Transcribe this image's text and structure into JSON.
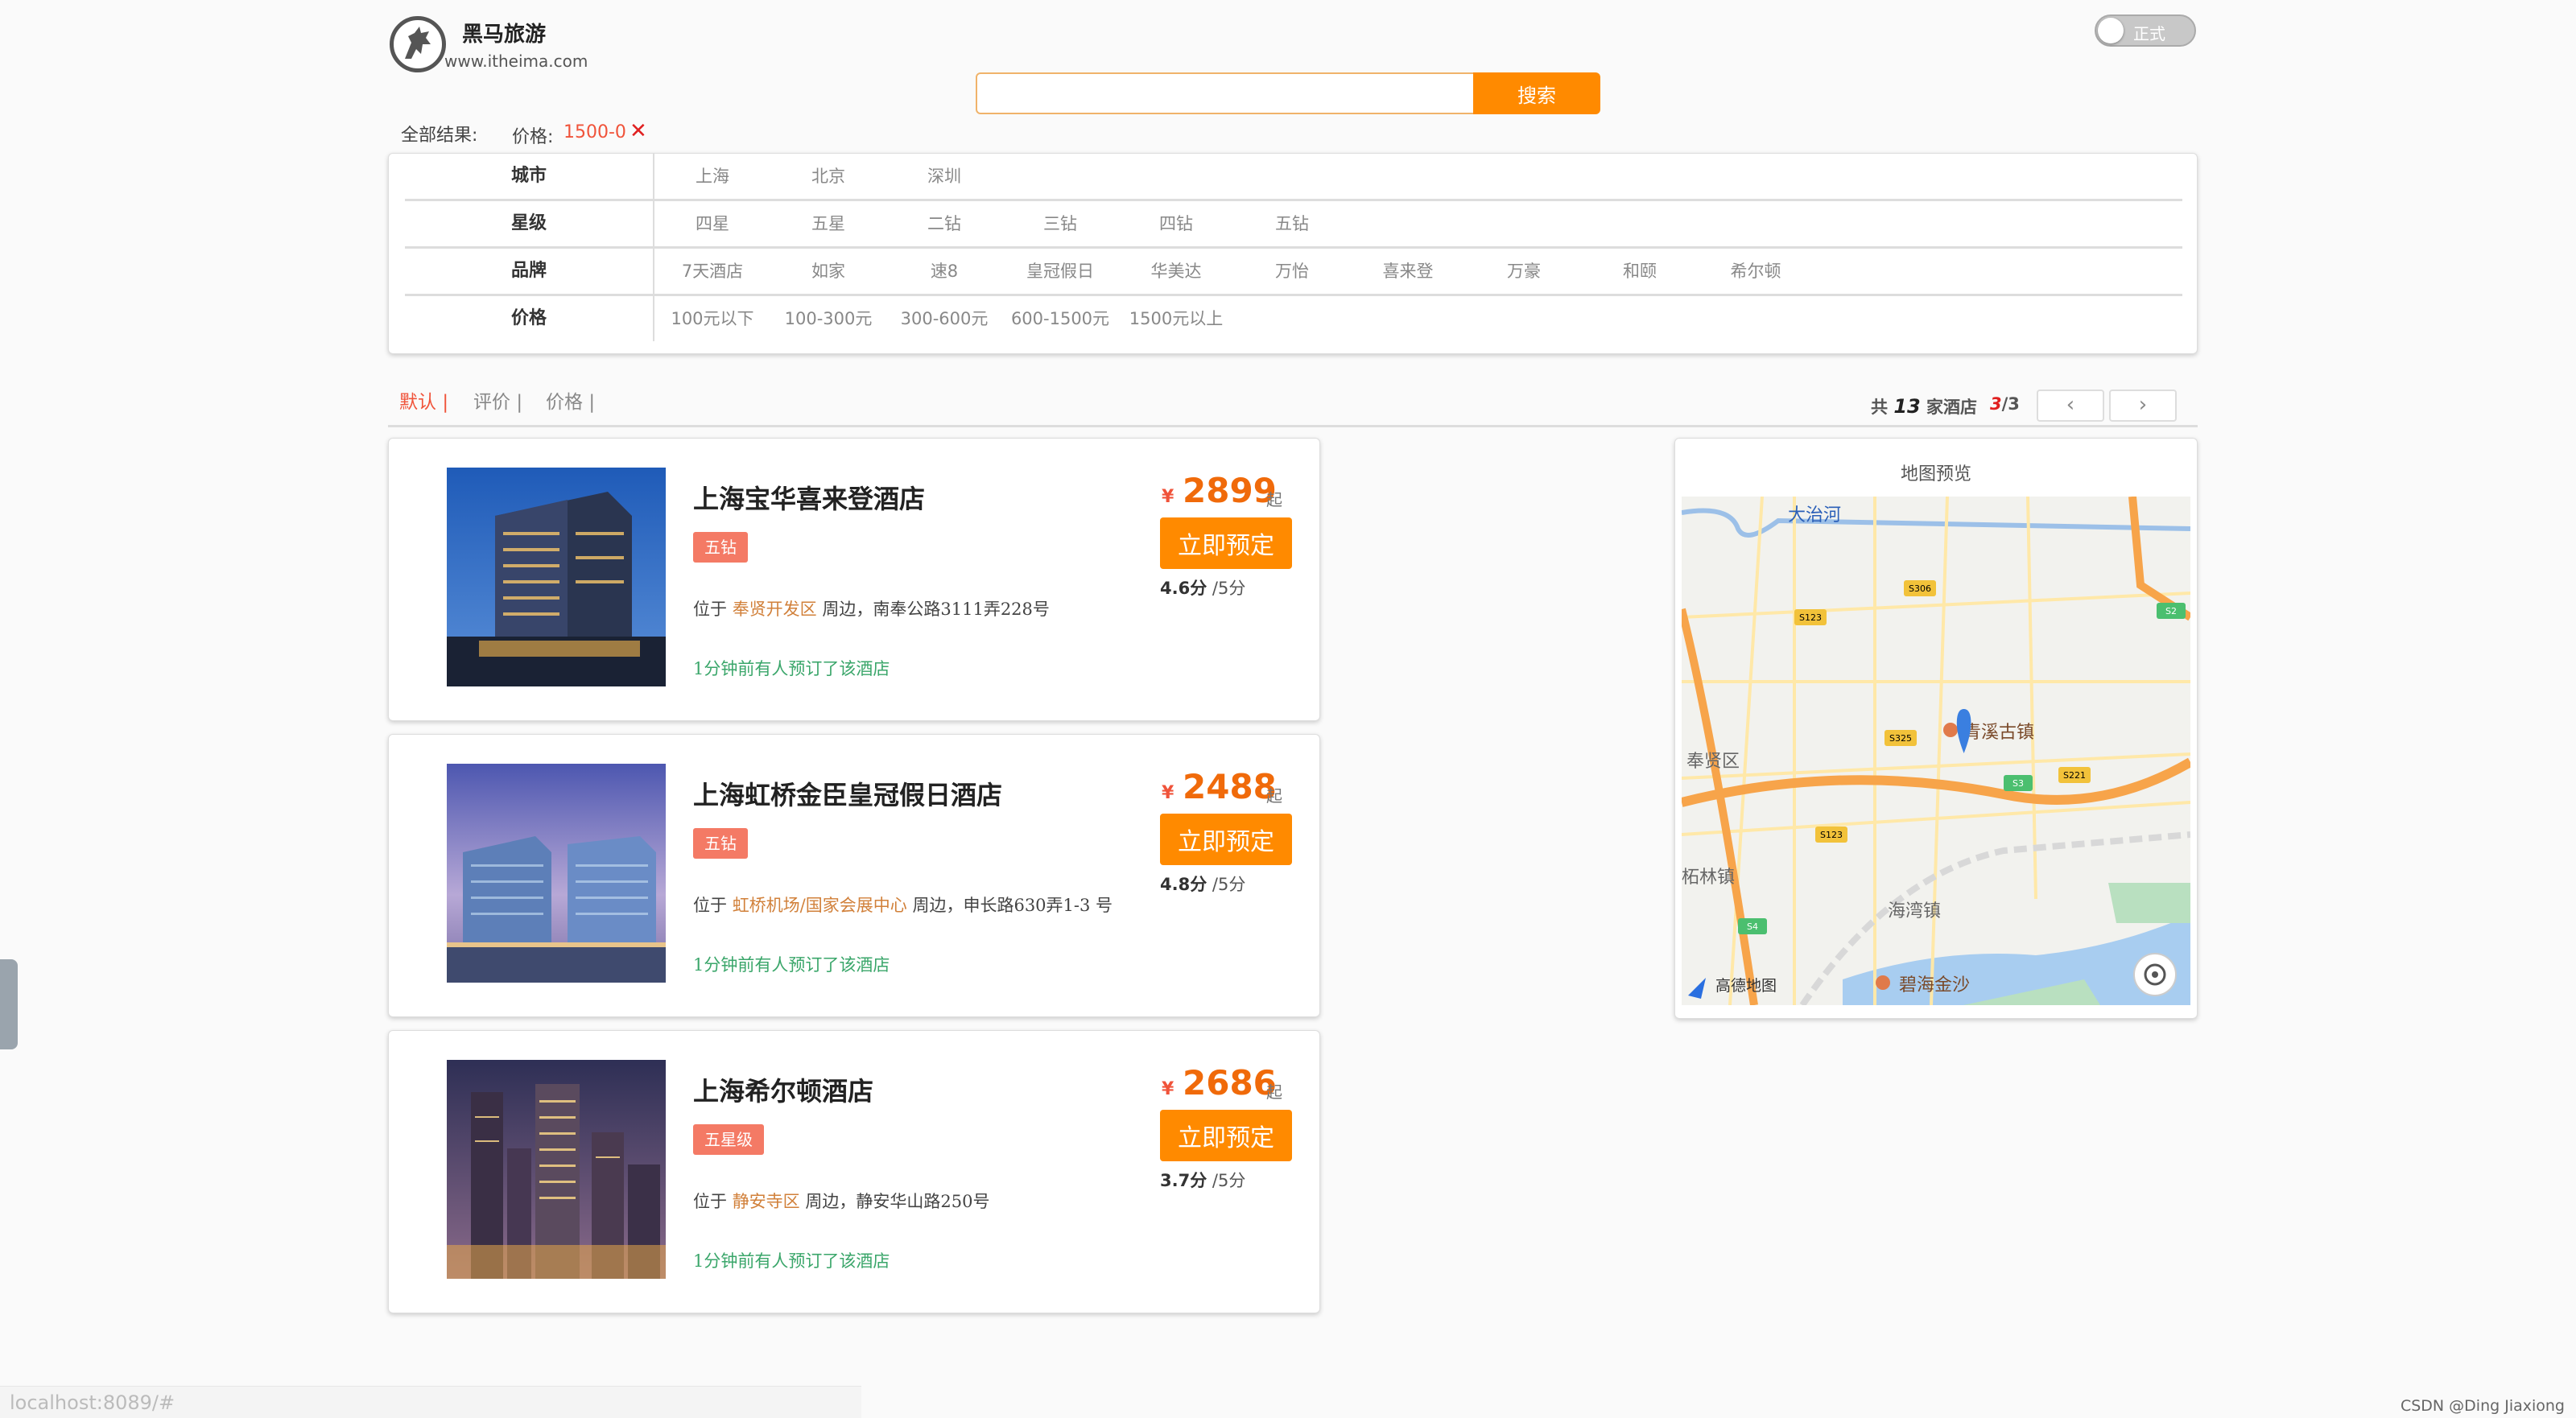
{
  "header": {
    "brand_name": "黑马旅游",
    "brand_url": "www.itheima.com",
    "search_placeholder": "",
    "search_button": "搜索",
    "toggle_label": "正式"
  },
  "filter_bar": {
    "result_label": "全部结果:",
    "price_label": "价格:",
    "price_value": "1500-0",
    "close_icon": "close-icon"
  },
  "filters": [
    {
      "label": "城市",
      "options": [
        "上海",
        "北京",
        "深圳"
      ]
    },
    {
      "label": "星级",
      "options": [
        "四星",
        "五星",
        "二钻",
        "三钻",
        "四钻",
        "五钻"
      ]
    },
    {
      "label": "品牌",
      "options": [
        "7天酒店",
        "如家",
        "速8",
        "皇冠假日",
        "华美达",
        "万怡",
        "喜来登",
        "万豪",
        "和颐",
        "希尔顿"
      ]
    },
    {
      "label": "价格",
      "options": [
        "100元以下",
        "100-300元",
        "300-600元",
        "600-1500元",
        "1500元以上"
      ]
    }
  ],
  "sort": {
    "default": "默认",
    "rating": "评价",
    "price": "价格",
    "separator": "|"
  },
  "pager": {
    "total_prefix": "共",
    "total": "13",
    "total_suffix": "家酒店",
    "current": "3",
    "pages": "/3",
    "prev_icon": "chevron-left-icon",
    "next_icon": "chevron-right-icon"
  },
  "hotels": [
    {
      "name": "上海宝华喜来登酒店",
      "tag": "五钻",
      "addr_prefix": "位于",
      "area": "奉贤开发区",
      "addr_suffix": "周边，南奉公路3111弄228号",
      "recent": "1分钟前有人预订了该酒店",
      "currency": "¥",
      "price": "2899",
      "price_suffix": "起",
      "book": "立即预定",
      "score": "4.6分",
      "score_max": "/5分"
    },
    {
      "name": "上海虹桥金臣皇冠假日酒店",
      "tag": "五钻",
      "addr_prefix": "位于",
      "area": "虹桥机场/国家会展中心",
      "addr_suffix": "周边，申长路630弄1-3 号",
      "recent": "1分钟前有人预订了该酒店",
      "currency": "¥",
      "price": "2488",
      "price_suffix": "起",
      "book": "立即预定",
      "score": "4.8分",
      "score_max": "/5分"
    },
    {
      "name": "上海希尔顿酒店",
      "tag": "五星级",
      "addr_prefix": "位于",
      "area": "静安寺区",
      "addr_suffix": "周边，静安华山路250号",
      "recent": "1分钟前有人预订了该酒店",
      "currency": "¥",
      "price": "2686",
      "price_suffix": "起",
      "book": "立即预定",
      "score": "3.7分",
      "score_max": "/5分"
    }
  ],
  "map": {
    "title": "地图预览",
    "labels": {
      "river": "大治河",
      "town": "青溪古镇",
      "district": "奉贤区",
      "zhelin": "柘林镇",
      "haiwan": "海湾镇",
      "bihai": "碧海金沙",
      "logo": "高德地图"
    },
    "road_badges": [
      "S306",
      "S123",
      "S2",
      "S325",
      "S221",
      "S3",
      "S123",
      "S4"
    ]
  },
  "footer": {
    "status_url": "localhost:8089/#",
    "watermark": "CSDN @Ding Jiaxiong"
  },
  "colors": {
    "accent": "#ff8a00",
    "price": "#f06a0a",
    "active_sort": "#f0533a",
    "tag": "#f47a65",
    "recent": "#3aa66a"
  }
}
